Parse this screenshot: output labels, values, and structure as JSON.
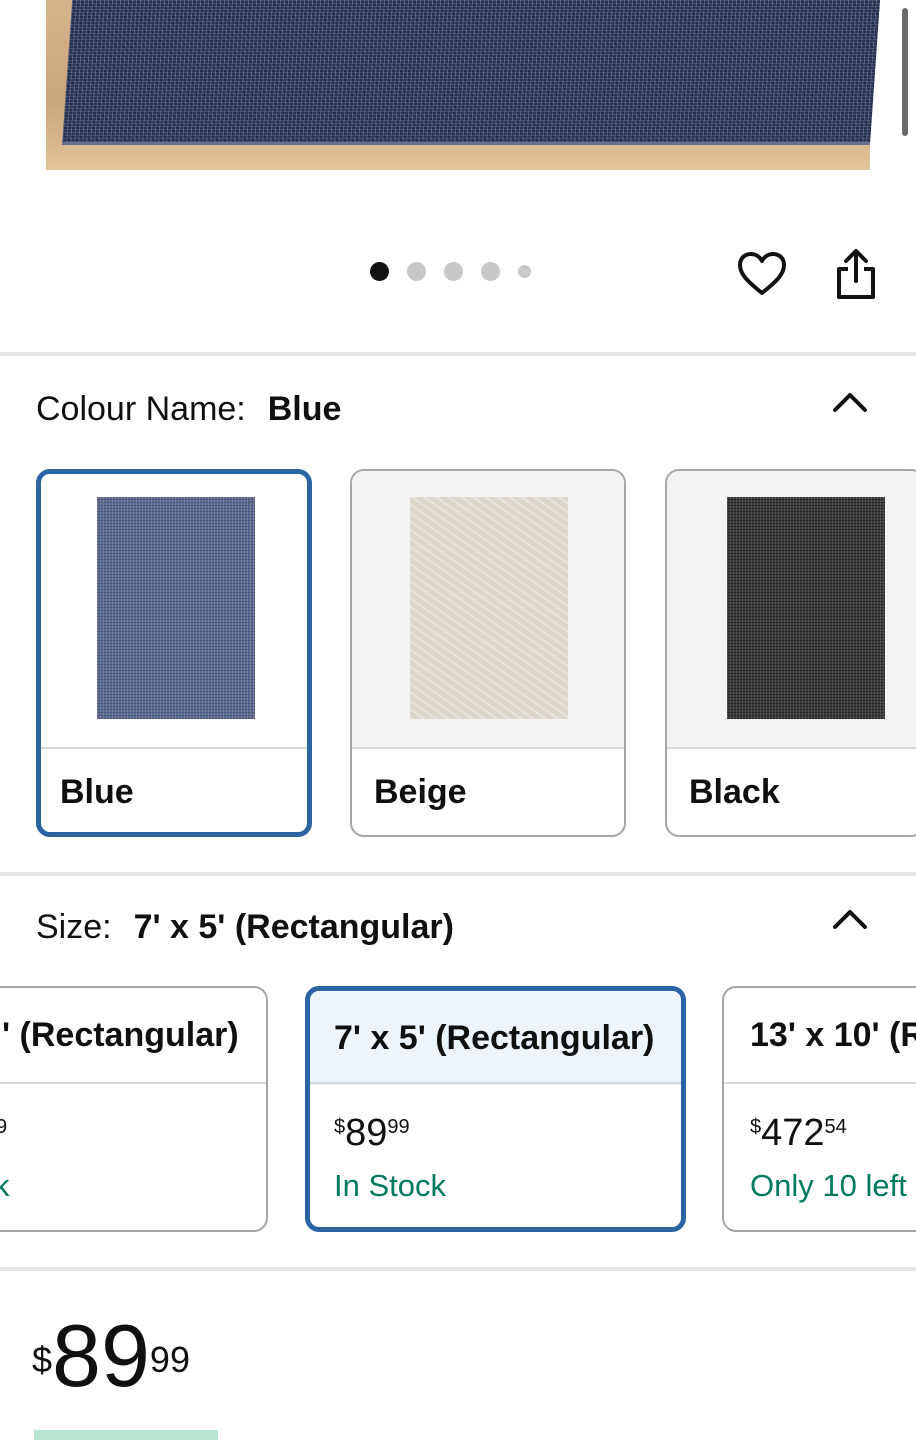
{
  "carousel": {
    "dot_count": 5,
    "active_index": 0
  },
  "actions": {
    "favorite_icon": "heart-icon",
    "share_icon": "share-icon"
  },
  "colour": {
    "label": "Colour Name:",
    "selected": "Blue",
    "options": [
      {
        "name": "Blue",
        "selected": true
      },
      {
        "name": "Beige",
        "selected": false
      },
      {
        "name": "Black",
        "selected": false
      }
    ]
  },
  "size": {
    "label": "Size:",
    "selected": "7' x 5' (Rectangular)",
    "options": [
      {
        "name": "' (Rectangular)",
        "currency": "$",
        "whole": "",
        "fraction": "9",
        "availability": "k",
        "selected": false
      },
      {
        "name": "7' x 5' (Rectangular)",
        "currency": "$",
        "whole": "89",
        "fraction": "99",
        "availability": "In Stock",
        "selected": true
      },
      {
        "name": "13' x 10' (R",
        "currency": "$",
        "whole": "472",
        "fraction": "54",
        "availability": "Only 10 left",
        "selected": false
      }
    ]
  },
  "price": {
    "currency": "$",
    "whole": "89",
    "fraction": "99"
  },
  "colors": {
    "accent": "#2a64a3",
    "in_stock": "#007a5e",
    "selected_bg": "#edf5fc"
  }
}
